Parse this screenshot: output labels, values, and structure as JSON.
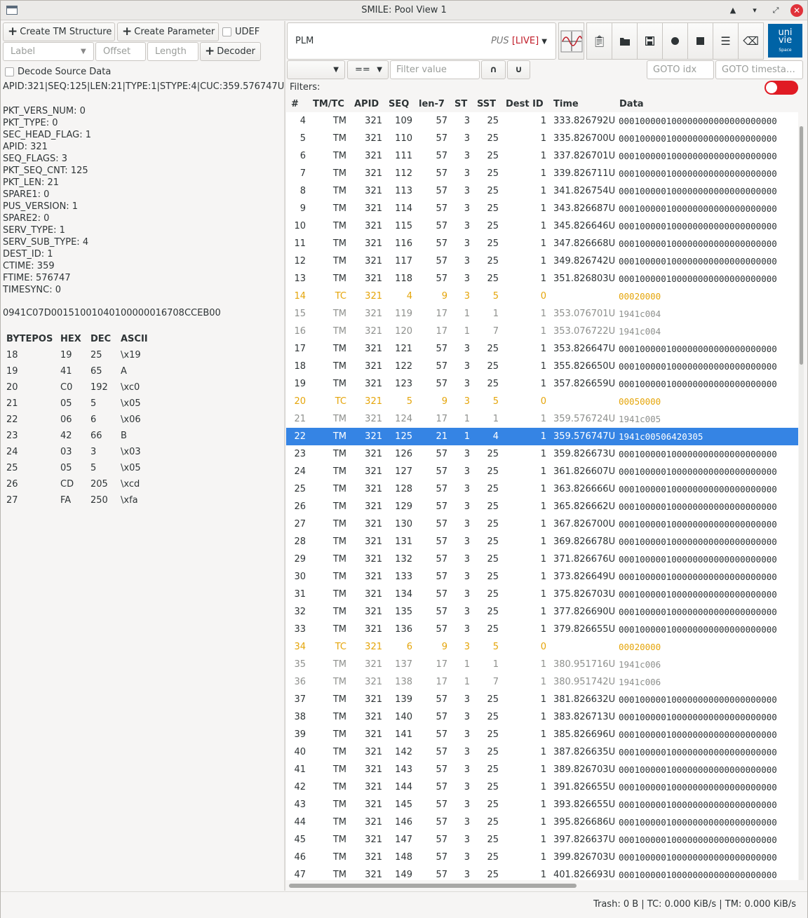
{
  "window": {
    "title": "SMILE: Pool View 1"
  },
  "left": {
    "create_tm_label": "Create TM Structure",
    "create_param_label": "Create Parameter",
    "udef_label": "UDEF",
    "label_placeholder": "Label",
    "offset_placeholder": "Offset",
    "length_placeholder": "Length",
    "decoder_label": "Decoder",
    "decode_source_label": "Decode Source Data",
    "summary": "APID:321|SEQ:125|LEN:21|TYPE:1|STYPE:4|CUC:359.576747U",
    "fields": [
      "PKT_VERS_NUM: 0",
      "PKT_TYPE: 0",
      "SEC_HEAD_FLAG: 1",
      "APID: 321",
      "SEQ_FLAGS: 3",
      "PKT_SEQ_CNT: 125",
      "PKT_LEN: 21",
      "SPARE1: 0",
      "PUS_VERSION: 1",
      "SPARE2: 0",
      "SERV_TYPE: 1",
      "SERV_SUB_TYPE: 4",
      "DEST_ID: 1",
      "CTIME: 359",
      "FTIME: 576747",
      "TIMESYNC: 0"
    ],
    "hex": "0941C07D00151001040100000016708CCEB00",
    "byte_headers": [
      "BYTEPOS",
      "HEX",
      "DEC",
      "ASCII"
    ],
    "bytes": [
      [
        "18",
        "19",
        "25",
        "\\x19"
      ],
      [
        "19",
        "41",
        "65",
        "A"
      ],
      [
        "20",
        "C0",
        "192",
        "\\xc0"
      ],
      [
        "21",
        "05",
        "5",
        "\\x05"
      ],
      [
        "22",
        "06",
        "6",
        "\\x06"
      ],
      [
        "23",
        "42",
        "66",
        "B"
      ],
      [
        "24",
        "03",
        "3",
        "\\x03"
      ],
      [
        "25",
        "05",
        "5",
        "\\x05"
      ],
      [
        "26",
        "CD",
        "205",
        "\\xcd"
      ],
      [
        "27",
        "FA",
        "250",
        "\\xfa"
      ]
    ]
  },
  "right": {
    "pool_name": "PLM",
    "pus_label": "PUS",
    "live_label": "[LIVE]",
    "op_label": "==",
    "filter_placeholder": "Filter value",
    "intersect_label": "∩",
    "union_label": "∪",
    "goto_idx_placeholder": "GOTO idx",
    "goto_ts_placeholder": "GOTO timesta…",
    "filters_label": "Filters:",
    "logo_top": "uni",
    "logo_mid": "vie",
    "logo_sub": "Space",
    "columns": [
      "#",
      "TM/TC",
      "APID",
      "SEQ",
      "len-7",
      "ST",
      "SST",
      "Dest ID",
      "Time",
      "Data"
    ],
    "rows": [
      [
        "4",
        "TM",
        "321",
        "109",
        "57",
        "3",
        "25",
        "1",
        "333.826792U",
        "000100000100000000000000000000",
        "tm"
      ],
      [
        "5",
        "TM",
        "321",
        "110",
        "57",
        "3",
        "25",
        "1",
        "335.826700U",
        "000100000100000000000000000000",
        "tm"
      ],
      [
        "6",
        "TM",
        "321",
        "111",
        "57",
        "3",
        "25",
        "1",
        "337.826701U",
        "000100000100000000000000000000",
        "tm"
      ],
      [
        "7",
        "TM",
        "321",
        "112",
        "57",
        "3",
        "25",
        "1",
        "339.826711U",
        "000100000100000000000000000000",
        "tm"
      ],
      [
        "8",
        "TM",
        "321",
        "113",
        "57",
        "3",
        "25",
        "1",
        "341.826754U",
        "000100000100000000000000000000",
        "tm"
      ],
      [
        "9",
        "TM",
        "321",
        "114",
        "57",
        "3",
        "25",
        "1",
        "343.826687U",
        "000100000100000000000000000000",
        "tm"
      ],
      [
        "10",
        "TM",
        "321",
        "115",
        "57",
        "3",
        "25",
        "1",
        "345.826646U",
        "000100000100000000000000000000",
        "tm"
      ],
      [
        "11",
        "TM",
        "321",
        "116",
        "57",
        "3",
        "25",
        "1",
        "347.826668U",
        "000100000100000000000000000000",
        "tm"
      ],
      [
        "12",
        "TM",
        "321",
        "117",
        "57",
        "3",
        "25",
        "1",
        "349.826742U",
        "000100000100000000000000000000",
        "tm"
      ],
      [
        "13",
        "TM",
        "321",
        "118",
        "57",
        "3",
        "25",
        "1",
        "351.826803U",
        "000100000100000000000000000000",
        "tm"
      ],
      [
        "14",
        "TC",
        "321",
        "4",
        "9",
        "3",
        "5",
        "0",
        "",
        "00020000",
        "tc"
      ],
      [
        "15",
        "TM",
        "321",
        "119",
        "17",
        "1",
        "1",
        "1",
        "353.076701U",
        "1941c004",
        "grey"
      ],
      [
        "16",
        "TM",
        "321",
        "120",
        "17",
        "1",
        "7",
        "1",
        "353.076722U",
        "1941c004",
        "grey"
      ],
      [
        "17",
        "TM",
        "321",
        "121",
        "57",
        "3",
        "25",
        "1",
        "353.826647U",
        "000100000100000000000000000000",
        "tm"
      ],
      [
        "18",
        "TM",
        "321",
        "122",
        "57",
        "3",
        "25",
        "1",
        "355.826650U",
        "000100000100000000000000000000",
        "tm"
      ],
      [
        "19",
        "TM",
        "321",
        "123",
        "57",
        "3",
        "25",
        "1",
        "357.826659U",
        "000100000100000000000000000000",
        "tm"
      ],
      [
        "20",
        "TC",
        "321",
        "5",
        "9",
        "3",
        "5",
        "0",
        "",
        "00050000",
        "tc"
      ],
      [
        "21",
        "TM",
        "321",
        "124",
        "17",
        "1",
        "1",
        "1",
        "359.576724U",
        "1941c005",
        "grey"
      ],
      [
        "22",
        "TM",
        "321",
        "125",
        "21",
        "1",
        "4",
        "1",
        "359.576747U",
        "1941c00506420305",
        "sel"
      ],
      [
        "23",
        "TM",
        "321",
        "126",
        "57",
        "3",
        "25",
        "1",
        "359.826673U",
        "000100000100000000000000000000",
        "tm"
      ],
      [
        "24",
        "TM",
        "321",
        "127",
        "57",
        "3",
        "25",
        "1",
        "361.826607U",
        "000100000100000000000000000000",
        "tm"
      ],
      [
        "25",
        "TM",
        "321",
        "128",
        "57",
        "3",
        "25",
        "1",
        "363.826666U",
        "000100000100000000000000000000",
        "tm"
      ],
      [
        "26",
        "TM",
        "321",
        "129",
        "57",
        "3",
        "25",
        "1",
        "365.826662U",
        "000100000100000000000000000000",
        "tm"
      ],
      [
        "27",
        "TM",
        "321",
        "130",
        "57",
        "3",
        "25",
        "1",
        "367.826700U",
        "000100000100000000000000000000",
        "tm"
      ],
      [
        "28",
        "TM",
        "321",
        "131",
        "57",
        "3",
        "25",
        "1",
        "369.826678U",
        "000100000100000000000000000000",
        "tm"
      ],
      [
        "29",
        "TM",
        "321",
        "132",
        "57",
        "3",
        "25",
        "1",
        "371.826676U",
        "000100000100000000000000000000",
        "tm"
      ],
      [
        "30",
        "TM",
        "321",
        "133",
        "57",
        "3",
        "25",
        "1",
        "373.826649U",
        "000100000100000000000000000000",
        "tm"
      ],
      [
        "31",
        "TM",
        "321",
        "134",
        "57",
        "3",
        "25",
        "1",
        "375.826703U",
        "000100000100000000000000000000",
        "tm"
      ],
      [
        "32",
        "TM",
        "321",
        "135",
        "57",
        "3",
        "25",
        "1",
        "377.826690U",
        "000100000100000000000000000000",
        "tm"
      ],
      [
        "33",
        "TM",
        "321",
        "136",
        "57",
        "3",
        "25",
        "1",
        "379.826655U",
        "000100000100000000000000000000",
        "tm"
      ],
      [
        "34",
        "TC",
        "321",
        "6",
        "9",
        "3",
        "5",
        "0",
        "",
        "00020000",
        "tc"
      ],
      [
        "35",
        "TM",
        "321",
        "137",
        "17",
        "1",
        "1",
        "1",
        "380.951716U",
        "1941c006",
        "grey"
      ],
      [
        "36",
        "TM",
        "321",
        "138",
        "17",
        "1",
        "7",
        "1",
        "380.951742U",
        "1941c006",
        "grey"
      ],
      [
        "37",
        "TM",
        "321",
        "139",
        "57",
        "3",
        "25",
        "1",
        "381.826632U",
        "000100000100000000000000000000",
        "tm"
      ],
      [
        "38",
        "TM",
        "321",
        "140",
        "57",
        "3",
        "25",
        "1",
        "383.826713U",
        "000100000100000000000000000000",
        "tm"
      ],
      [
        "39",
        "TM",
        "321",
        "141",
        "57",
        "3",
        "25",
        "1",
        "385.826696U",
        "000100000100000000000000000000",
        "tm"
      ],
      [
        "40",
        "TM",
        "321",
        "142",
        "57",
        "3",
        "25",
        "1",
        "387.826635U",
        "000100000100000000000000000000",
        "tm"
      ],
      [
        "41",
        "TM",
        "321",
        "143",
        "57",
        "3",
        "25",
        "1",
        "389.826703U",
        "000100000100000000000000000000",
        "tm"
      ],
      [
        "42",
        "TM",
        "321",
        "144",
        "57",
        "3",
        "25",
        "1",
        "391.826655U",
        "000100000100000000000000000000",
        "tm"
      ],
      [
        "43",
        "TM",
        "321",
        "145",
        "57",
        "3",
        "25",
        "1",
        "393.826655U",
        "000100000100000000000000000000",
        "tm"
      ],
      [
        "44",
        "TM",
        "321",
        "146",
        "57",
        "3",
        "25",
        "1",
        "395.826686U",
        "000100000100000000000000000000",
        "tm"
      ],
      [
        "45",
        "TM",
        "321",
        "147",
        "57",
        "3",
        "25",
        "1",
        "397.826637U",
        "000100000100000000000000000000",
        "tm"
      ],
      [
        "46",
        "TM",
        "321",
        "148",
        "57",
        "3",
        "25",
        "1",
        "399.826703U",
        "000100000100000000000000000000",
        "tm"
      ],
      [
        "47",
        "TM",
        "321",
        "149",
        "57",
        "3",
        "25",
        "1",
        "401.826693U",
        "000100000100000000000000000000",
        "tm"
      ]
    ]
  },
  "status": "Trash: 0 B | TC:  0.000 KiB/s | TM:  0.000 KiB/s",
  "colors": {
    "tc": "#e5a50a",
    "selection": "#3584e4",
    "live": "#c01c28",
    "logo": "#0063a6"
  }
}
